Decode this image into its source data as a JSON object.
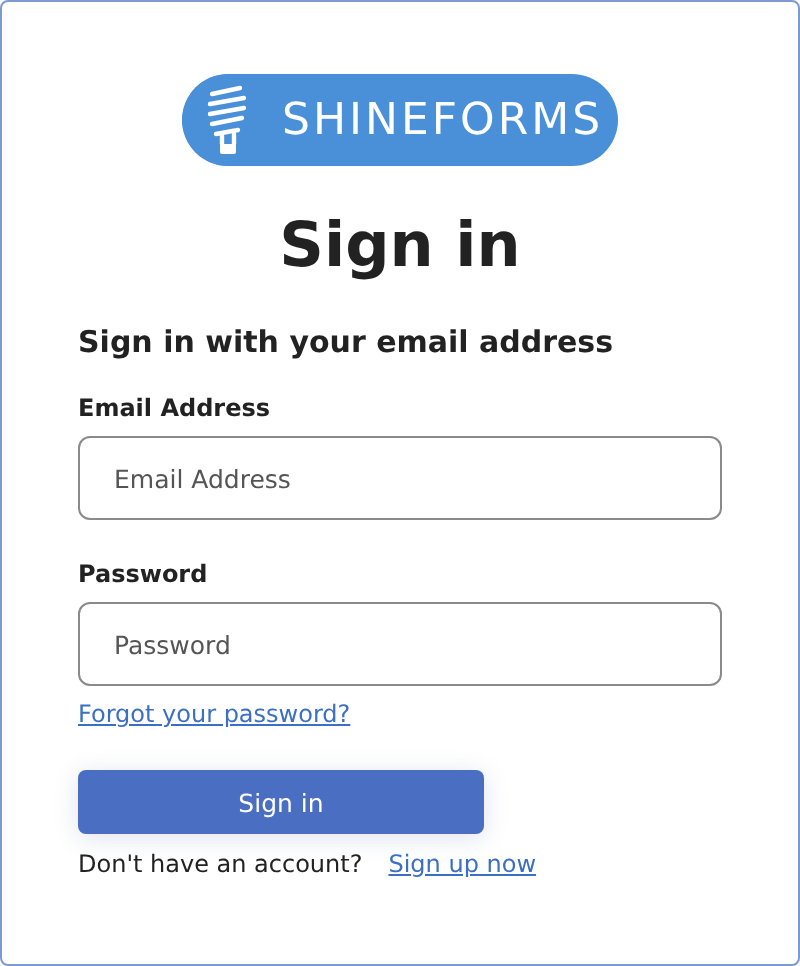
{
  "logo": {
    "text": "SHINEFORMS"
  },
  "title": "Sign in",
  "subtitle": "Sign in with your email address",
  "fields": [
    {
      "label": "Email Address",
      "placeholder": "Email Address"
    },
    {
      "label": "Password",
      "placeholder": "Password"
    }
  ],
  "forgot_link": "Forgot your password?",
  "submit_button": "Sign in",
  "signup": {
    "prompt": "Don't have an account?",
    "link": "Sign up now"
  }
}
